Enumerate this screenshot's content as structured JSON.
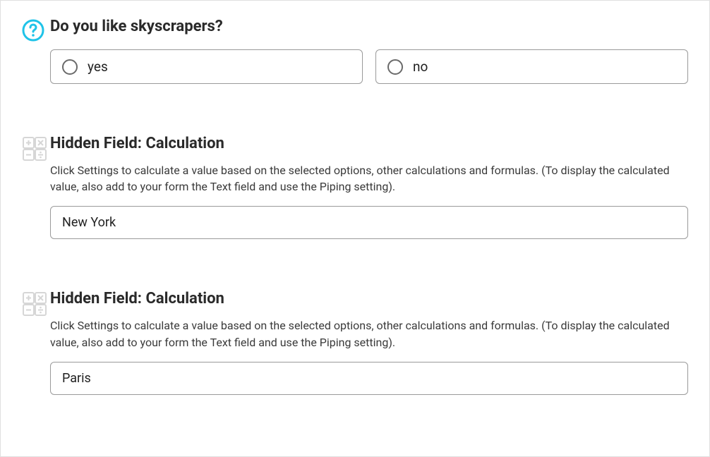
{
  "question": {
    "title": "Do you like skyscrapers?",
    "options": [
      {
        "label": "yes"
      },
      {
        "label": "no"
      }
    ]
  },
  "hidden_fields": [
    {
      "title": "Hidden Field: Calculation",
      "description": "Click Settings to calculate a value based on the selected options, other calculations and formulas. (To display the calculated value, also add to your form the Text field and use the Piping setting).",
      "value": "New York"
    },
    {
      "title": "Hidden Field: Calculation",
      "description": "Click Settings to calculate a value based on the selected options, other calculations and formulas. (To display the calculated value, also add to your form the Text field and use the Piping setting).",
      "value": "Paris"
    }
  ]
}
